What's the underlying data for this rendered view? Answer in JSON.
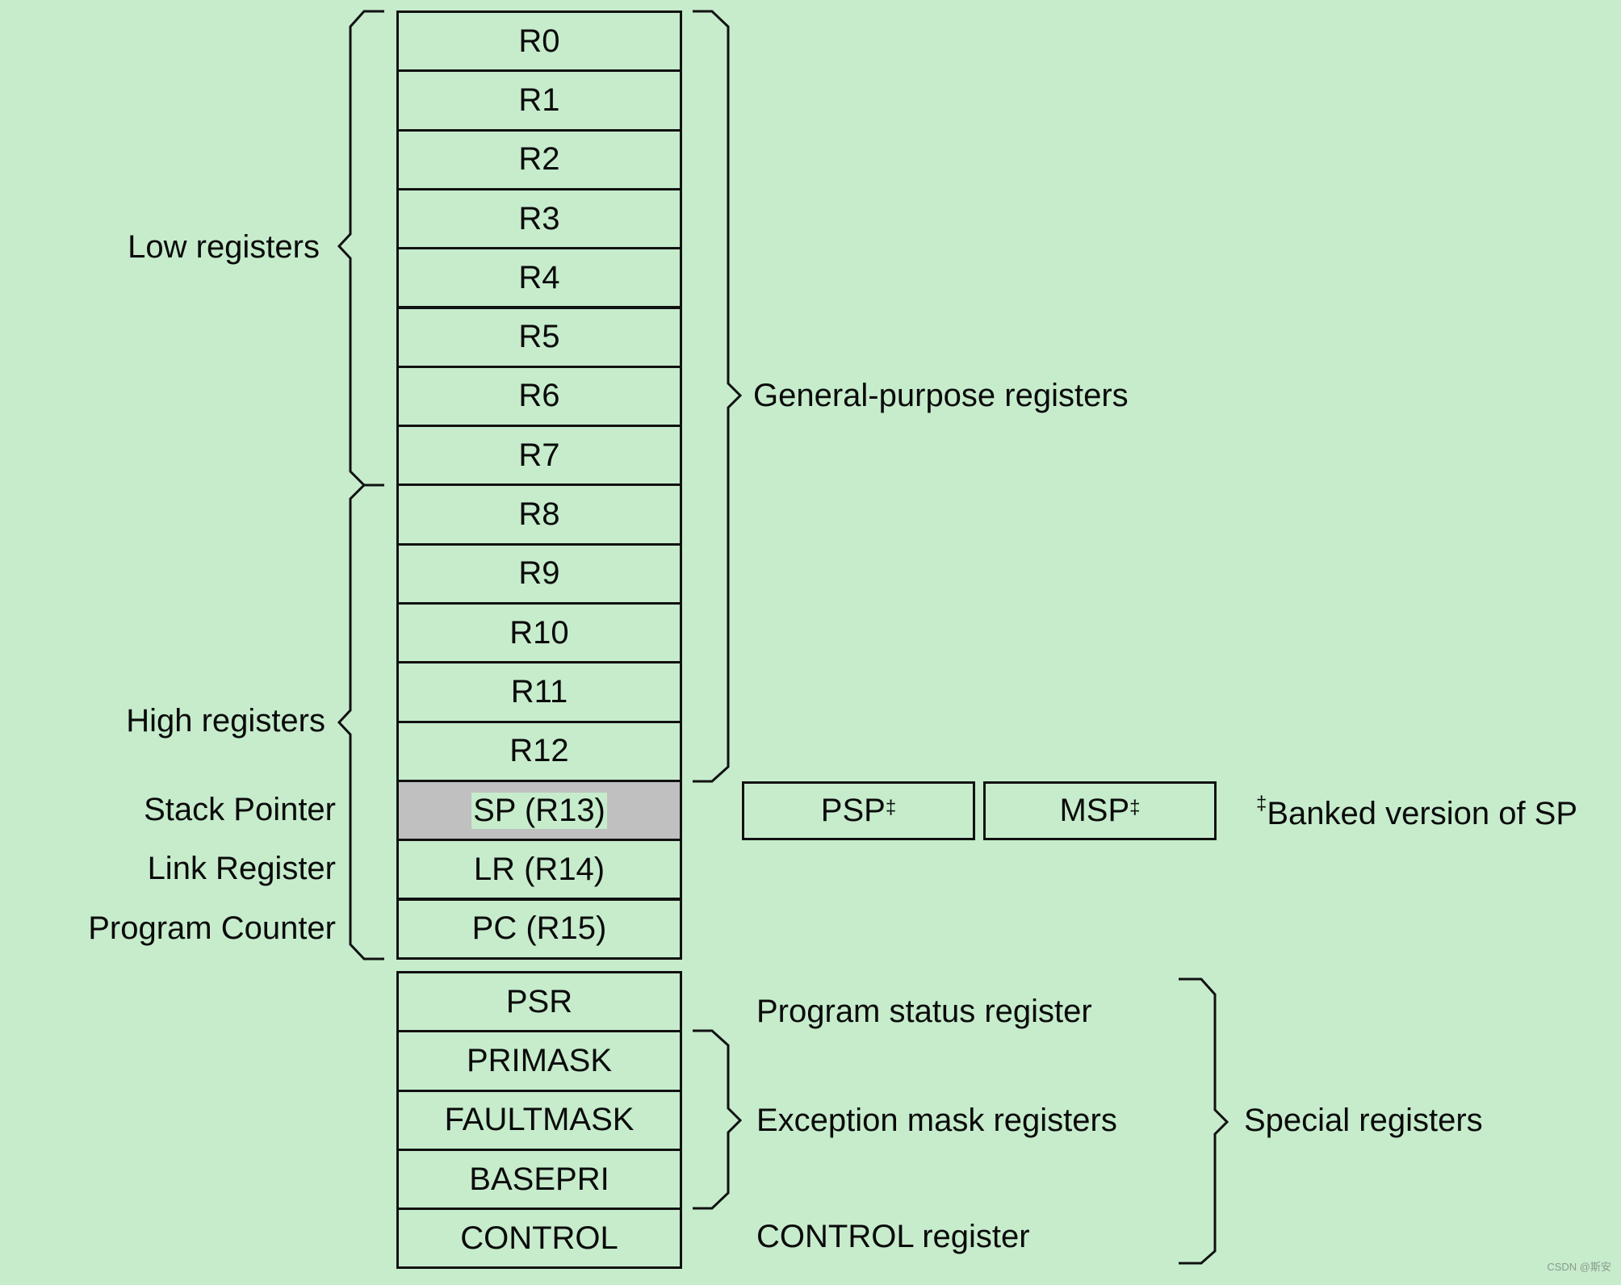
{
  "core_registers": [
    {
      "name": "R0"
    },
    {
      "name": "R1"
    },
    {
      "name": "R2"
    },
    {
      "name": "R3"
    },
    {
      "name": "R4"
    },
    {
      "name": "R5"
    },
    {
      "name": "R6"
    },
    {
      "name": "R7"
    },
    {
      "name": "R8"
    },
    {
      "name": "R9"
    },
    {
      "name": "R10"
    },
    {
      "name": "R11"
    },
    {
      "name": "R12"
    },
    {
      "name": "SP (R13)",
      "highlighted": true
    },
    {
      "name": "LR (R14)"
    },
    {
      "name": "PC (R15)"
    }
  ],
  "special_registers": [
    {
      "name": "PSR"
    },
    {
      "name": "PRIMASK"
    },
    {
      "name": "FAULTMASK"
    },
    {
      "name": "BASEPRI"
    },
    {
      "name": "CONTROL"
    }
  ],
  "left_labels": {
    "low": "Low registers",
    "high": "High registers",
    "sp": "Stack Pointer",
    "lr": "Link Register",
    "pc": "Program Counter"
  },
  "right_labels": {
    "general_purpose": "General-purpose registers",
    "psr": "Program status register",
    "exception_mask": "Exception mask registers",
    "control": "CONTROL register",
    "special": "Special registers"
  },
  "banked": {
    "psp": "PSP",
    "msp": "MSP",
    "mark": "‡",
    "note": "Banked version of SP"
  },
  "colors": {
    "background": "#c6eccc",
    "highlight": "#c0c0c0",
    "line": "#111111"
  },
  "watermark": "CSDN @斯安"
}
